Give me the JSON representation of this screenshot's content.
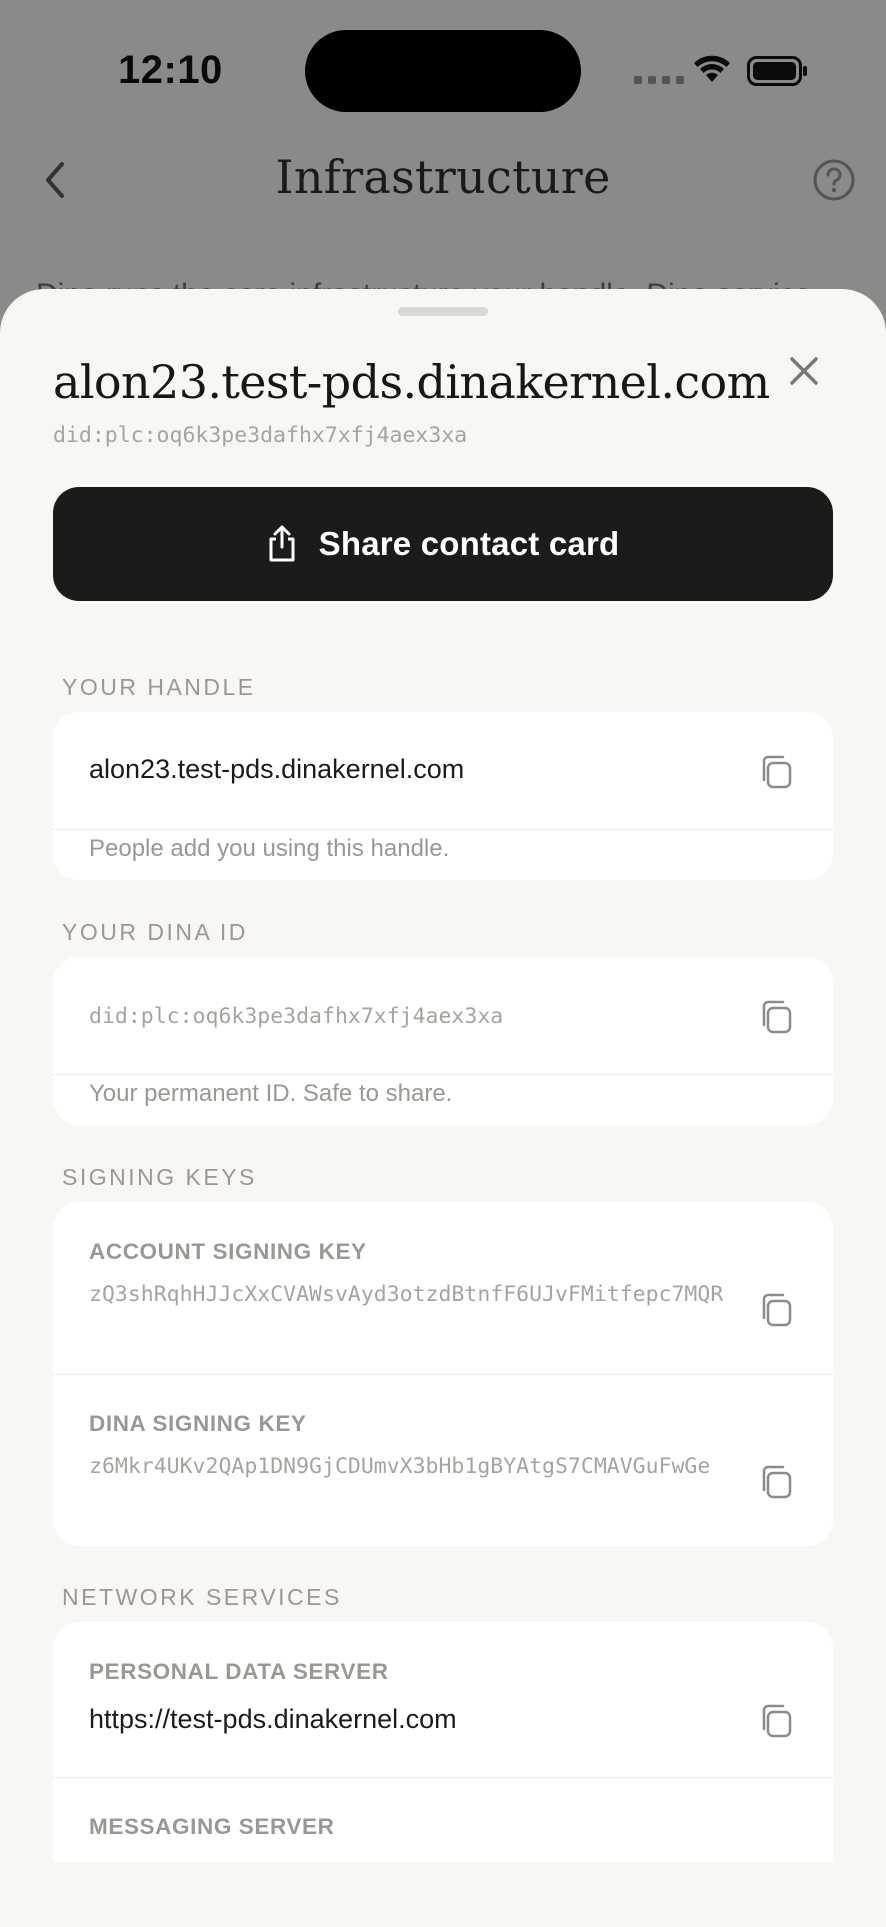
{
  "status_bar": {
    "time": "12:10"
  },
  "nav": {
    "title": "Infrastructure"
  },
  "background": {
    "partial_text": "Dina runs the core infrastructure your handle, Dina service"
  },
  "sheet": {
    "title": "alon23.test-pds.dinakernel.com",
    "did": "did:plc:oq6k3pe3dafhx7xfj4aex3xa",
    "share_label": "Share contact card"
  },
  "handle": {
    "section_label": "YOUR HANDLE",
    "value": "alon23.test-pds.dinakernel.com",
    "hint": "People add you using this handle."
  },
  "dina_id": {
    "section_label": "YOUR DINA ID",
    "value": "did:plc:oq6k3pe3dafhx7xfj4aex3xa",
    "hint": "Your permanent ID. Safe to share."
  },
  "signing_keys": {
    "section_label": "SIGNING KEYS",
    "account_label": "ACCOUNT SIGNING KEY",
    "account_value": "zQ3shRqhHJJcXxCVAWsvAyd3otzdBtnfF6UJvFMitfepc7MQR",
    "dina_label": "DINA SIGNING KEY",
    "dina_value": "z6Mkr4UKv2QAp1DN9GjCDUmvX3bHb1gBYAtgS7CMAVGuFwGe"
  },
  "network": {
    "section_label": "NETWORK SERVICES",
    "pds_label": "PERSONAL DATA SERVER",
    "pds_value": "https://test-pds.dinakernel.com",
    "messaging_label": "MESSAGING SERVER"
  },
  "colors": {
    "overlay": "#8a8a89",
    "sheet_bg": "#f8f7f4",
    "card_bg": "#ffffff",
    "primary_button": "#1c1b1a",
    "muted_text": "#9b9893"
  },
  "icons": [
    "back-chevron-icon",
    "help-circle-icon",
    "close-icon",
    "share-icon",
    "copy-icon",
    "wifi-icon",
    "battery-icon"
  ]
}
